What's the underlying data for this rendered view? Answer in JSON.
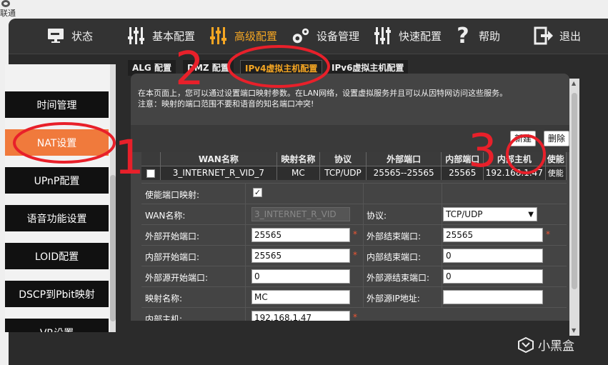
{
  "logo": {
    "text": "联通"
  },
  "nav": [
    {
      "label": "状态",
      "icon": "monitor-icon"
    },
    {
      "label": "基本配置",
      "icon": "sliders-icon"
    },
    {
      "label": "高级配置",
      "icon": "advanced-sliders-icon",
      "active": true
    },
    {
      "label": "设备管理",
      "icon": "gears-icon"
    },
    {
      "label": "快速配置",
      "icon": "sliders-icon"
    },
    {
      "label": "帮助",
      "icon": "question-icon"
    },
    {
      "label": "退出",
      "icon": "logout-icon"
    }
  ],
  "sub_tabs": [
    {
      "label": "ALG 配置"
    },
    {
      "label": "DMZ 配置"
    },
    {
      "label": "IPv4虚拟主机配置",
      "active": true
    },
    {
      "label": "IPv6虚拟主机配置"
    }
  ],
  "sidebar": {
    "items": [
      {
        "label": "时间管理"
      },
      {
        "label": "NAT设置",
        "active": true
      },
      {
        "label": "UPnP配置"
      },
      {
        "label": "语音功能设置"
      },
      {
        "label": "LOID配置"
      },
      {
        "label": "DSCP到Pbit映射"
      },
      {
        "label": "VR设置"
      }
    ]
  },
  "notice": {
    "line1": "在本页面上，您可以通过设置端口映射参数。在LAN网络，设置虚拟服务并且可以从因特网访问这些服务。",
    "line2": "注意：映射的端口范围不要和语音的知名端口冲突!"
  },
  "buttons": {
    "new": "新建",
    "delete": "删除"
  },
  "table": {
    "headers": [
      "",
      "WAN名称",
      "映射名称",
      "协议",
      "外部端口",
      "内部端口",
      "内部主机",
      "使能"
    ],
    "rows": [
      {
        "wan": "3_INTERNET_R_VID_7",
        "name": "MC",
        "protocol": "TCP/UDP",
        "ext_port": "25565--25565",
        "int_port": "25565",
        "host": "192.168.1.47",
        "enable": "使能"
      }
    ]
  },
  "form": {
    "enable_label": "使能端口映射:",
    "enable_checked": "✓",
    "wan_label": "WAN名称:",
    "wan_value": "3_INTERNET_R_VID",
    "protocol_label": "协议:",
    "protocol_value": "TCP/UDP",
    "ext_start_label": "外部开始端口:",
    "ext_start_value": "25565",
    "ext_end_label": "外部结束端口:",
    "ext_end_value": "25565",
    "int_start_label": "内部开始端口:",
    "int_start_value": "25565",
    "int_end_label": "内部结束端口:",
    "int_end_value": "0",
    "src_start_label": "外部源开始端口:",
    "src_start_value": "0",
    "src_end_label": "外部源结束端口:",
    "src_end_value": "0",
    "map_name_label": "映射名称:",
    "map_name_value": "MC",
    "src_ip_label": "外部源IP地址:",
    "src_ip_value": "",
    "host_label": "内部主机:",
    "host_value": "192.168.1.47",
    "required_mark": "*"
  },
  "watermark": {
    "text": "小黑盒"
  },
  "annotations": {
    "one": "1",
    "two": "2",
    "three": "3"
  },
  "colors": {
    "accent": "#f5a623",
    "active_side": "#f07a3c",
    "annotation": "#e8202a"
  }
}
